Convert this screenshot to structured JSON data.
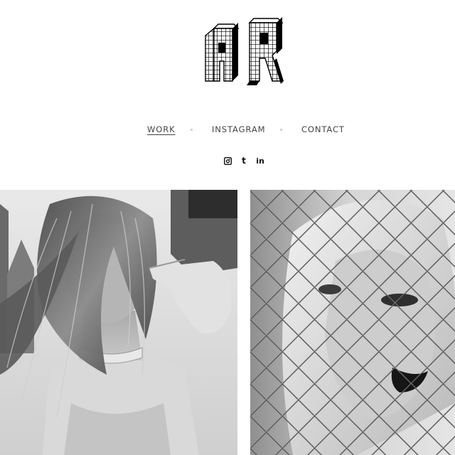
{
  "brand": {
    "logo_text": "AR",
    "logo_icon": "pixel-block-monogram"
  },
  "nav": {
    "items": [
      {
        "label": "WORK",
        "active": true
      },
      {
        "label": "INSTAGRAM",
        "active": false
      },
      {
        "label": "CONTACT",
        "active": false
      }
    ]
  },
  "social": {
    "items": [
      {
        "icon": "instagram-icon",
        "glyph": "◙"
      },
      {
        "icon": "tumblr-icon",
        "glyph": "t"
      },
      {
        "icon": "linkedin-icon",
        "glyph": "in"
      }
    ]
  },
  "gallery": {
    "items": [
      {
        "name": "portrait-windblown-hair",
        "description_icon": "photo"
      },
      {
        "name": "portrait-chain-link-fence",
        "description_icon": "photo"
      }
    ]
  },
  "colors": {
    "background": "#ffffff",
    "text": "#444444",
    "dot": "#c9c9c9"
  }
}
